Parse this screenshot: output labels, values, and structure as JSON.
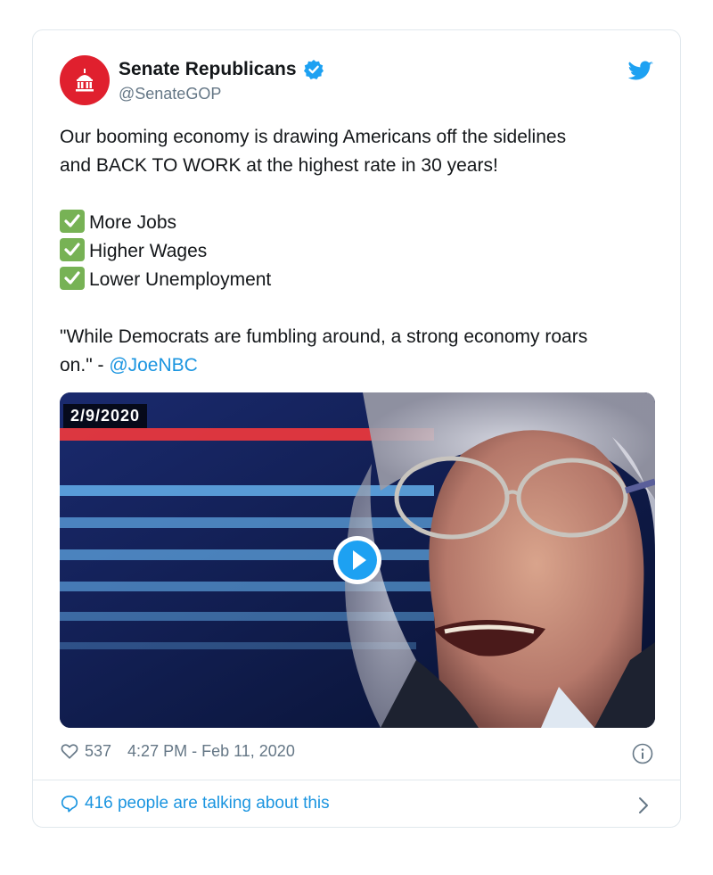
{
  "account": {
    "name": "Senate Republicans",
    "handle": "@SenateGOP",
    "avatar_color": "#e0202e",
    "verified_color": "#1da1f2"
  },
  "tweet": {
    "text_line1": "Our booming economy is drawing Americans off the sidelines",
    "text_line2": "and BACK TO WORK at the highest rate in 30 years!",
    "checklist": [
      "More Jobs",
      "Higher Wages",
      "Lower Unemployment"
    ],
    "quote_line1": "\"While Democrats are fumbling around, a strong economy roars",
    "quote_line2_prefix": "on.\" - ",
    "quote_mention": "@JoeNBC"
  },
  "media": {
    "date_label": "2/9/2020",
    "play_icon": "play-circle-icon"
  },
  "meta": {
    "likes": "537",
    "timestamp": "4:27 PM - Feb 11, 2020"
  },
  "footer": {
    "talking": "416 people are talking about this"
  },
  "colors": {
    "link": "#1b95e0",
    "check": "#77b255",
    "muted": "#657786"
  }
}
